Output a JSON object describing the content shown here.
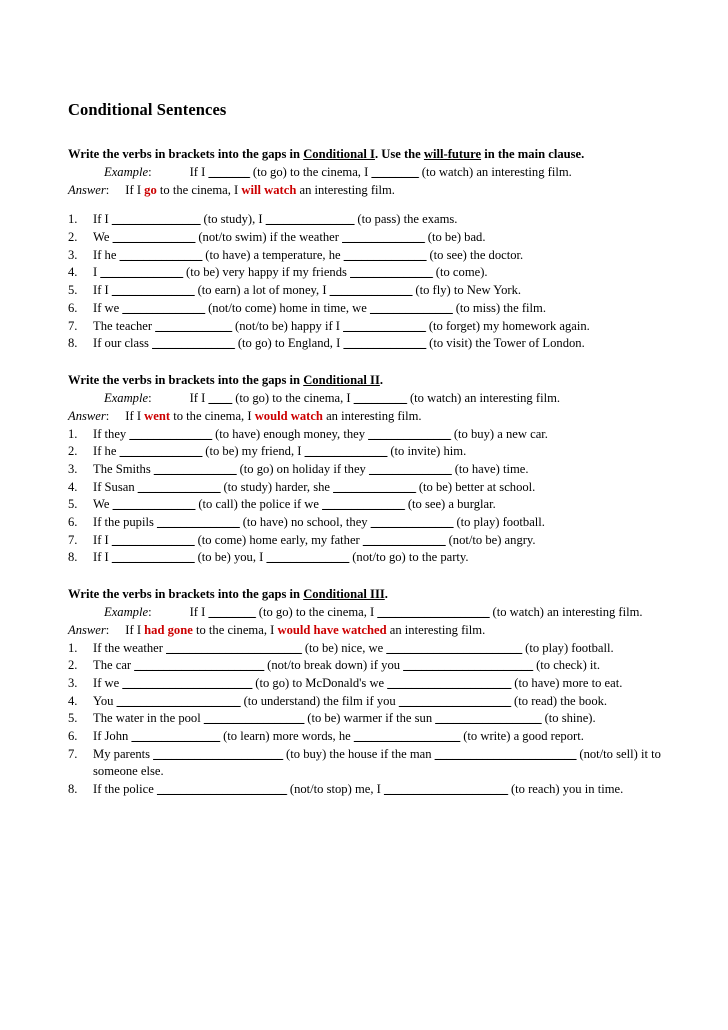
{
  "document": {
    "title": "Conditional Sentences",
    "example_label": "Example",
    "answer_label": "Answer",
    "colon": ":",
    "accent_color": "#cc0000"
  },
  "sections": [
    {
      "heading_pre": "Write the verbs in brackets into the gaps in ",
      "heading_underlined_1": "Conditional I",
      "heading_mid": ". Use the ",
      "heading_underlined_2": "will-future",
      "heading_post": " in the main clause.",
      "example_text_1": "If I ",
      "example_gap_1": "_______",
      "example_text_2": " (to go) to the cinema, I ",
      "example_gap_2": "________",
      "example_text_3": " (to watch) an interesting film.",
      "answer_text_1": "If I ",
      "answer_red_1": "go",
      "answer_text_2": " to the cinema, I ",
      "answer_red_2": "will watch",
      "answer_text_3": " an interesting film.",
      "items": [
        {
          "num": "1.",
          "parts": [
            "If I ",
            "_______________",
            " (to study), I ",
            "_______________",
            " (to pass) the exams."
          ]
        },
        {
          "num": "2.",
          "parts": [
            "We ",
            "______________",
            " (not/to swim) if the weather ",
            "______________",
            " (to be) bad."
          ]
        },
        {
          "num": "3.",
          "parts": [
            "If he ",
            "______________",
            " (to have) a temperature, he ",
            "______________",
            " (to see) the doctor."
          ]
        },
        {
          "num": "4.",
          "parts": [
            "I ",
            "______________",
            " (to be) very happy if my friends ",
            "______________",
            " (to come)."
          ]
        },
        {
          "num": "5.",
          "parts": [
            "If I ",
            "______________",
            " (to earn) a lot of money, I ",
            "______________",
            " (to fly) to New York."
          ]
        },
        {
          "num": "6.",
          "parts": [
            "If we ",
            "______________",
            " (not/to come) home in time, we ",
            "______________",
            " (to miss) the film."
          ]
        },
        {
          "num": "7.",
          "parts": [
            "The teacher ",
            "_____________",
            " (not/to be) happy if I ",
            "______________",
            " (to forget) my homework again."
          ]
        },
        {
          "num": "8.",
          "parts": [
            "If our class ",
            "______________",
            " (to go) to England, I ",
            "______________",
            " (to visit) the Tower of London."
          ]
        }
      ]
    },
    {
      "heading_pre": "Write the verbs in brackets into the gaps in ",
      "heading_underlined_1": "Conditional II",
      "heading_mid": "",
      "heading_underlined_2": "",
      "heading_post": ".",
      "example_text_1": "If I ",
      "example_gap_1": "____",
      "example_text_2": " (to go) to the cinema, I ",
      "example_gap_2": "_________",
      "example_text_3": " (to watch) an interesting film.",
      "answer_text_1": "If I ",
      "answer_red_1": "went",
      "answer_text_2": " to the cinema, I ",
      "answer_red_2": "would watch",
      "answer_text_3": " an interesting film.",
      "items": [
        {
          "num": "1.",
          "parts": [
            "If they ",
            "______________",
            " (to have) enough money, they ",
            "______________",
            " (to buy) a new car."
          ]
        },
        {
          "num": "2.",
          "parts": [
            "If he ",
            "______________",
            " (to be) my friend, I ",
            "______________",
            " (to invite) him."
          ]
        },
        {
          "num": "3.",
          "parts": [
            "The Smiths ",
            "______________",
            " (to go) on holiday if they ",
            "______________",
            " (to have) time."
          ]
        },
        {
          "num": "4.",
          "parts": [
            "If Susan ",
            "______________",
            " (to study) harder, she ",
            "______________",
            " (to be) better at school."
          ]
        },
        {
          "num": "5.",
          "parts": [
            "We ",
            "______________",
            " (to call) the police if we ",
            "______________",
            " (to see) a burglar."
          ]
        },
        {
          "num": "6.",
          "parts": [
            "If the pupils ",
            "______________",
            " (to have) no school, they ",
            "______________",
            " (to play) football."
          ]
        },
        {
          "num": "7.",
          "parts": [
            "If I ",
            "______________",
            " (to come) home early, my father ",
            "______________",
            " (not/to be) angry."
          ]
        },
        {
          "num": "8.",
          "parts": [
            "If I ",
            "______________",
            " (to be) you, I ",
            "______________",
            " (not/to go) to the party."
          ]
        }
      ]
    },
    {
      "heading_pre": "Write the verbs in brackets into the gaps in ",
      "heading_underlined_1": "Conditional III",
      "heading_mid": "",
      "heading_underlined_2": "",
      "heading_post": ".",
      "example_text_1": "If I ",
      "example_gap_1": "________",
      "example_text_2": " (to go) to the cinema, I ",
      "example_gap_2": "___________________",
      "example_text_3": " (to watch) an interesting film.",
      "answer_text_1": "If I ",
      "answer_red_1": "had gone",
      "answer_text_2": " to the cinema, I ",
      "answer_red_2": "would have watched",
      "answer_text_3": " an interesting film.",
      "items": [
        {
          "num": "1.",
          "parts": [
            "If the weather ",
            "_______________________",
            " (to be) nice, we ",
            "_______________________",
            " (to play) football."
          ]
        },
        {
          "num": "2.",
          "parts": [
            "The car ",
            "______________________",
            " (not/to break down) if you ",
            "______________________",
            " (to check) it."
          ]
        },
        {
          "num": "3.",
          "parts": [
            "If we ",
            "______________________",
            " (to go) to McDonald's we ",
            "_____________________",
            " (to have) more to eat."
          ]
        },
        {
          "num": "4.",
          "parts": [
            "You ",
            "_____________________",
            " (to understand) the film if you ",
            "___________________",
            " (to read) the book."
          ]
        },
        {
          "num": "5.",
          "parts": [
            "The water in the pool ",
            "_________________",
            " (to be) warmer if the sun ",
            "__________________",
            " (to shine)."
          ]
        },
        {
          "num": "6.",
          "parts": [
            "If John ",
            "_______________",
            " (to learn) more words, he ",
            "__________________",
            " (to write) a good report."
          ]
        },
        {
          "num": "7.",
          "parts": [
            "My parents ",
            "______________________",
            " (to buy) the house if the man ",
            "________________________",
            " (not/to sell) it to someone else."
          ]
        },
        {
          "num": "8.",
          "parts": [
            "If the police ",
            "______________________",
            " (not/to stop) me, I ",
            "_____________________",
            " (to reach) you in time."
          ]
        }
      ]
    }
  ]
}
